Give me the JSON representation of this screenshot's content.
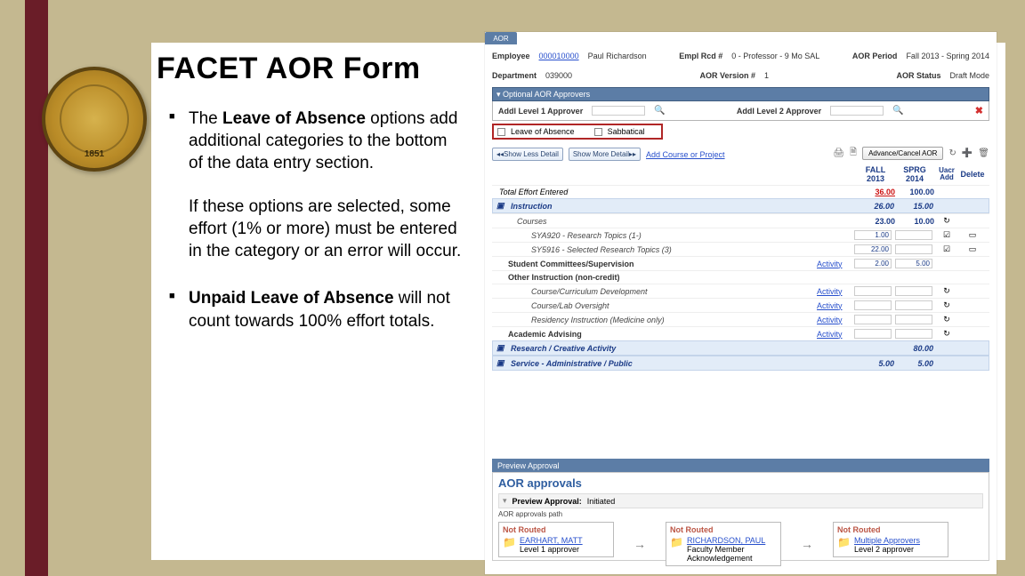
{
  "slide": {
    "title": "FACET AOR Form",
    "bullets": [
      {
        "lead": "The ",
        "bold": "Leave of Absence",
        "tail": " options add additional categories to the bottom of the data entry section.",
        "para2": "If these options are selected, some effort (1% or more) must be entered in the category or an error will occur."
      },
      {
        "bold": "Unpaid Leave of Absence",
        "tail": " will not count towards 100% effort totals."
      }
    ],
    "seal_year": "1851"
  },
  "shot": {
    "tab": "AOR",
    "header1": {
      "employee_lbl": "Employee",
      "employee_link": "000010000",
      "employee_name": "Paul Richardson",
      "emplrcd_lbl": "Empl Rcd #",
      "emplrcd_val": "0 - Professor - 9 Mo SAL",
      "period_lbl": "AOR Period",
      "period_val": "Fall 2013 - Spring 2014"
    },
    "header2": {
      "dept_lbl": "Department",
      "dept_val": "039000",
      "ver_lbl": "AOR Version #",
      "ver_val": "1",
      "status_lbl": "AOR Status",
      "status_val": "Draft Mode"
    },
    "approvers_bar": "▾ Optional AOR Approvers",
    "approvers": {
      "l1_lbl": "Addl Level 1 Approver",
      "l2_lbl": "Addl Level 2 Approver"
    },
    "leave_options": {
      "loa": "Leave of Absence",
      "sab": "Sabbatical"
    },
    "toolbar": {
      "show_less": "◂◂Show Less Detail",
      "show_more": "Show More Detail▸▸",
      "add_link": "Add Course or Project",
      "print_icon": "🖨",
      "export_icon": "🗎",
      "advance": "Advance/Cancel AOR",
      "redo": "↻",
      "add": "➕",
      "del": "🗑"
    },
    "cols": {
      "fall": "FALL 2013",
      "spring": "SPRG 2014",
      "uacr": "Uacr Add",
      "delete": "Delete"
    },
    "rows": {
      "total": {
        "label": "Total Effort Entered",
        "fall": "36.00",
        "spring": "100.00"
      },
      "instruction": {
        "label": "Instruction",
        "fall": "26.00",
        "spring": "15.00"
      },
      "courses": {
        "label": "Courses",
        "fall": "23.00",
        "spring": "10.00"
      },
      "course1": {
        "label": "SYA920 - Research Topics (1-)",
        "fall": "1.00",
        "spring": ""
      },
      "course2": {
        "label": "SY5916 - Selected Research Topics (3)",
        "fall": "22.00",
        "spring": ""
      },
      "stud": {
        "label": "Student Committees/Supervision",
        "act": "Activity",
        "fall": "2.00",
        "spring": "5.00"
      },
      "other_hdr": "Other Instruction (non-credit)",
      "ccd": {
        "label": "Course/Curriculum Development",
        "act": "Activity"
      },
      "clo": {
        "label": "Course/Lab Oversight",
        "act": "Activity"
      },
      "rim": {
        "label": "Residency Instruction (Medicine only)",
        "act": "Activity"
      },
      "adv": {
        "label": "Academic Advising",
        "act": "Activity"
      },
      "research": {
        "label": "Research / Creative Activity",
        "fall": "",
        "spring": "80.00"
      },
      "service": {
        "label": "Service - Administrative / Public",
        "fall": "5.00",
        "spring": "5.00"
      }
    },
    "preview_bar": "Preview Approval",
    "preview": {
      "title": "AOR approvals",
      "sub_lead": "Preview Approval:",
      "sub_state": "Initiated",
      "path_lbl": "AOR approvals path",
      "cards": [
        {
          "hdr": "Not Routed",
          "name": "EARHART, MATT",
          "role": "Level 1 approver"
        },
        {
          "hdr": "Not Routed",
          "name": "RICHARDSON, PAUL",
          "role": "Faculty Member Acknowledgement"
        },
        {
          "hdr": "Not Routed",
          "name": "Multiple Approvers",
          "role": "Level 2 approver"
        }
      ]
    }
  }
}
